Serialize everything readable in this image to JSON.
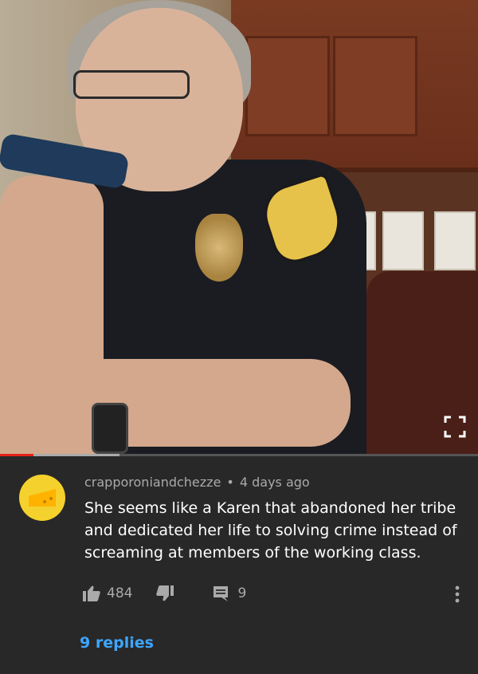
{
  "video": {
    "progress_fraction": 0.07,
    "buffer_fraction": 0.25,
    "fullscreen_icon": "fullscreen-icon",
    "accent_color": "#e62117"
  },
  "comment": {
    "author": "crapporoniandchezze",
    "separator": "•",
    "time_ago": "4 days ago",
    "text": "She seems like a Karen that abandoned her tribe and dedicated her life to solving crime instead of screaming at members of the working class.",
    "avatar_icon": "cheese-icon",
    "like_count": "484",
    "reply_count": "9",
    "replies_link": "9 replies",
    "link_color": "#3ea6ff"
  }
}
